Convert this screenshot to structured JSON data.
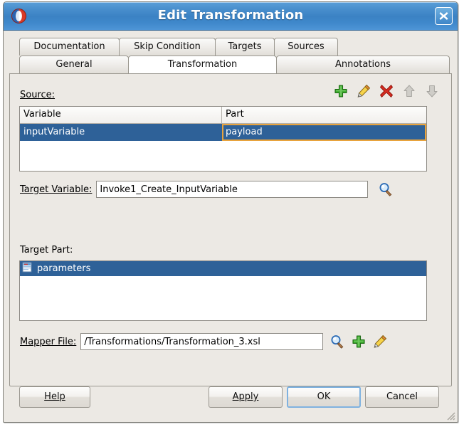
{
  "window": {
    "title": "Edit Transformation",
    "app_icon": "oracle-jdeveloper-icon",
    "close_icon": "close-icon"
  },
  "tabs": {
    "row1": [
      {
        "label": "Documentation",
        "active": false
      },
      {
        "label": "Skip Condition",
        "active": false
      },
      {
        "label": "Targets",
        "active": false
      },
      {
        "label": "Sources",
        "active": false
      }
    ],
    "row2": [
      {
        "label": "General",
        "active": false
      },
      {
        "label": "Transformation",
        "active": true
      },
      {
        "label": "Annotations",
        "active": false
      }
    ]
  },
  "source": {
    "label": "Source:",
    "toolbar": [
      {
        "name": "add-icon",
        "title": "Add",
        "enabled": true
      },
      {
        "name": "edit-pencil-icon",
        "title": "Edit",
        "enabled": true
      },
      {
        "name": "delete-icon",
        "title": "Delete",
        "enabled": true
      },
      {
        "name": "move-up-icon",
        "title": "Move Up",
        "enabled": false
      },
      {
        "name": "move-down-icon",
        "title": "Move Down",
        "enabled": false
      }
    ],
    "columns": [
      "Variable",
      "Part"
    ],
    "rows": [
      {
        "variable": "inputVariable",
        "part": "payload",
        "selected": true
      }
    ]
  },
  "target_variable": {
    "label": "Target Variable:",
    "value": "Invoke1_Create_InputVariable",
    "browse_icon": "search-icon"
  },
  "target_part": {
    "label": "Target Part:",
    "items": [
      {
        "label": "parameters",
        "icon": "xml-document-icon",
        "selected": true
      }
    ]
  },
  "mapper_file": {
    "label": "Mapper File:",
    "value": "/Transformations/Transformation_3.xsl",
    "actions": [
      {
        "name": "search-icon",
        "title": "Browse"
      },
      {
        "name": "add-icon",
        "title": "Create"
      },
      {
        "name": "edit-pencil-icon",
        "title": "Edit"
      }
    ]
  },
  "buttons": {
    "help": "Help",
    "apply": "Apply",
    "ok": "OK",
    "cancel": "Cancel"
  },
  "colors": {
    "titlebar": "#3b82c4",
    "selection": "#2e6198",
    "focus_cell": "#e8a33d",
    "focus_button": "#7fb2e0",
    "panel": "#ece9e4"
  }
}
